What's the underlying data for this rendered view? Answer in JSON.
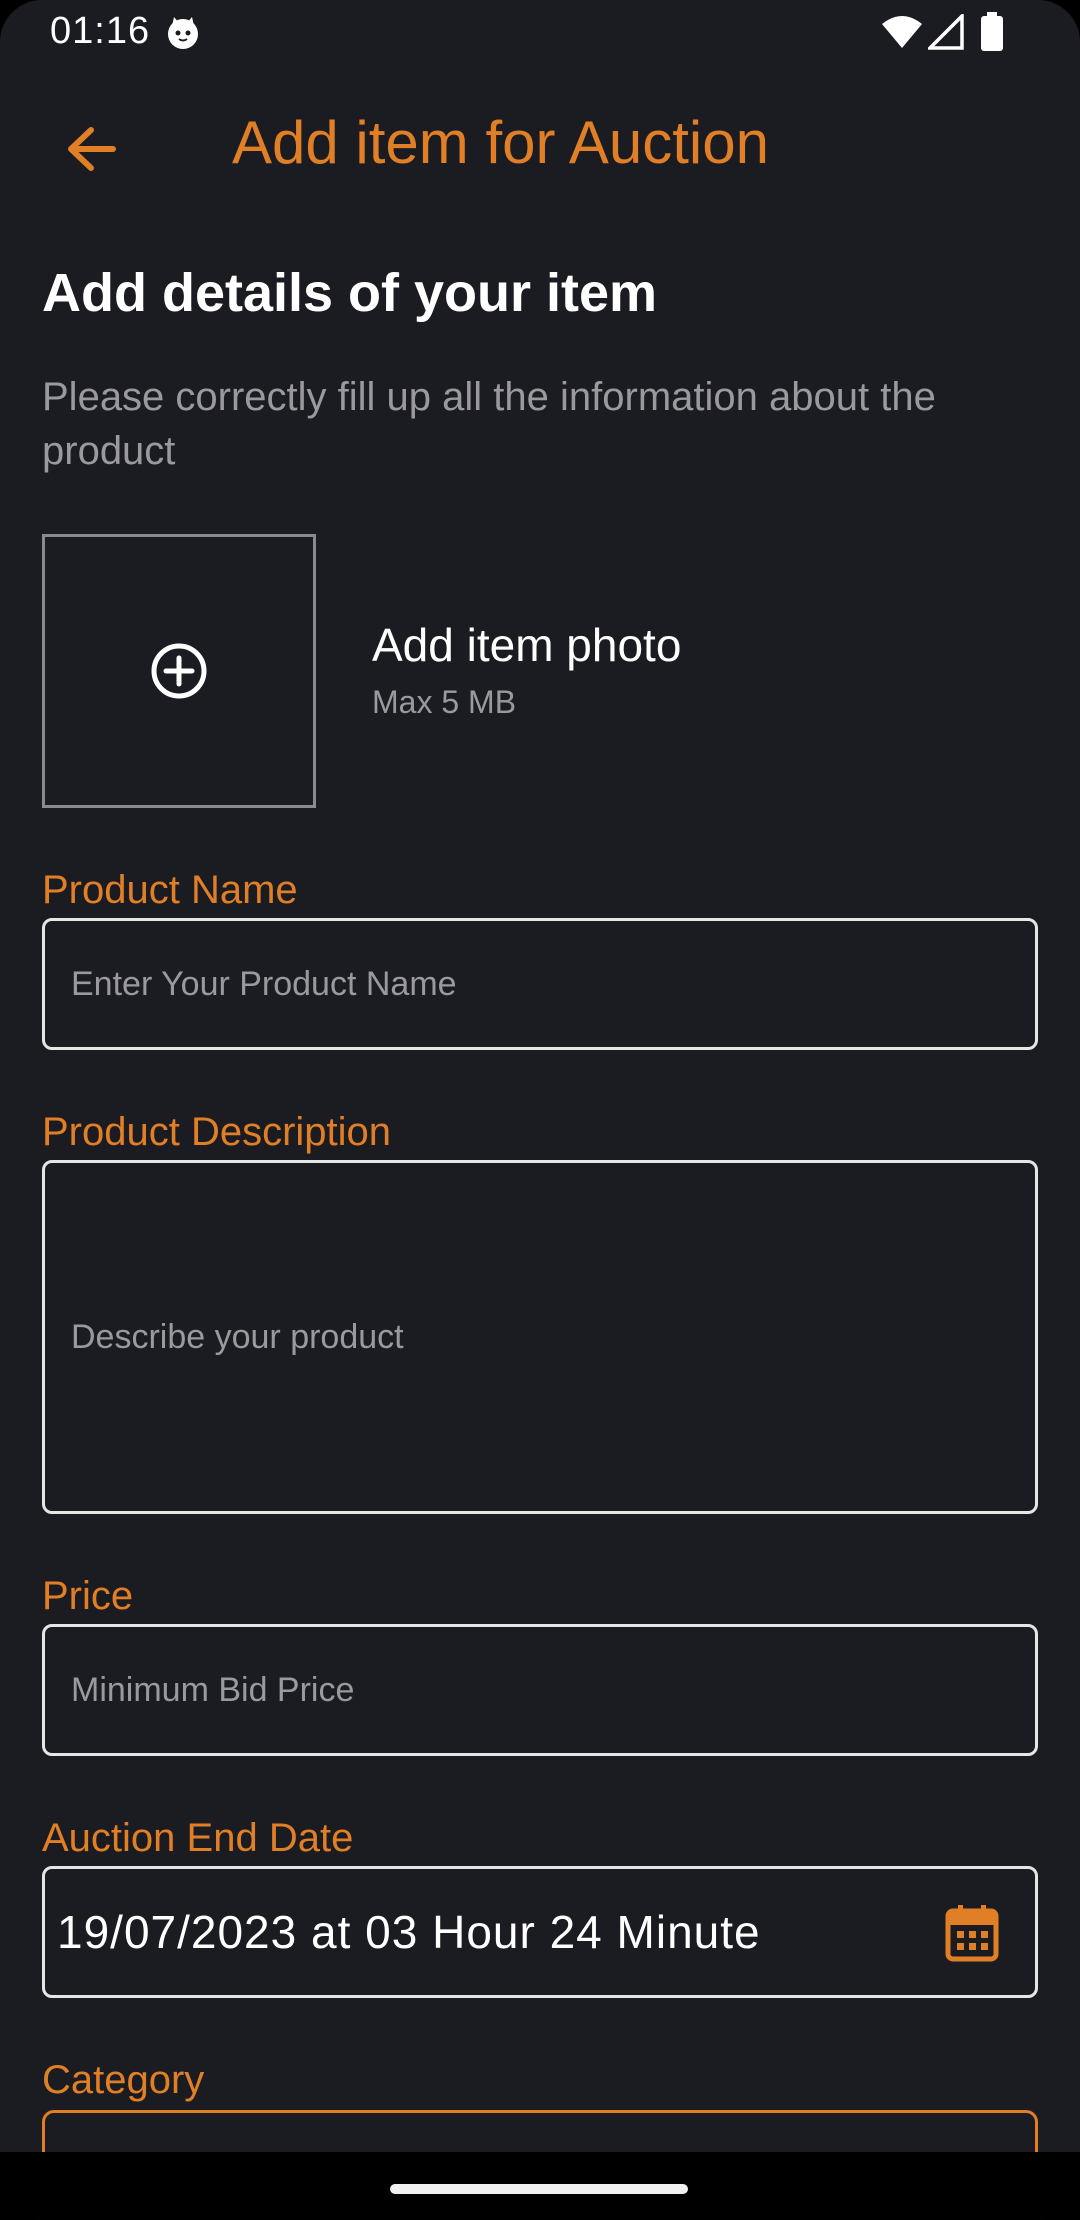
{
  "status_bar": {
    "time": "01:16",
    "icons": [
      "notification-cat-icon",
      "wifi-icon",
      "signal-icon",
      "battery-icon"
    ]
  },
  "app_bar": {
    "title": "Add item for Auction",
    "back_icon": "arrow-left-icon"
  },
  "header": {
    "title": "Add details of your item",
    "subtitle": "Please correctly fill up all the information about the product"
  },
  "photo": {
    "title": "Add item photo",
    "subtitle": "Max 5 MB",
    "icon": "plus-circle-icon"
  },
  "fields": {
    "product_name": {
      "label": "Product Name",
      "placeholder": "Enter Your Product Name"
    },
    "product_description": {
      "label": "Product Description",
      "placeholder": "Describe your product"
    },
    "price": {
      "label": "Price",
      "placeholder": "Minimum Bid Price"
    },
    "auction_end_date": {
      "label": "Auction End Date",
      "value": "19/07/2023 at 03 Hour 24 Minute",
      "icon": "calendar-icon"
    },
    "category": {
      "label": "Category"
    }
  },
  "colors": {
    "accent": "#e07f26",
    "background": "#1b1c21",
    "text": "#ffffff",
    "muted": "#9a9a9e"
  }
}
